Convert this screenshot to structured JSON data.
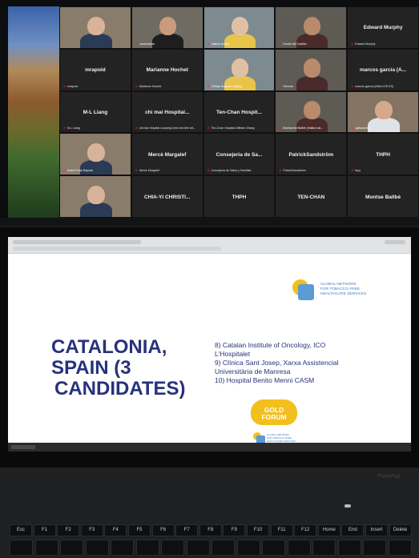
{
  "video_call": {
    "participants": [
      {
        "name": "",
        "tag": "",
        "camera": true
      },
      {
        "name": "",
        "tag": "Laura Antón",
        "camera": true
      },
      {
        "name": "",
        "tag": "Valeria Scalco",
        "camera": true
      },
      {
        "name": "",
        "tag": "Doctor del Castillo",
        "camera": true
      },
      {
        "name": "Edward Murphy",
        "tag": "Edward Murphy",
        "camera": false
      },
      {
        "name": "mrapoid",
        "tag": "mrapoid",
        "camera": false
      },
      {
        "name": "Marianne Hochet",
        "tag": "Marianne Hochet",
        "camera": false
      },
      {
        "name": "",
        "tag": "Chihay Hospital Ltiaying",
        "camera": true
      },
      {
        "name": "",
        "tag": "Veronia",
        "camera": true
      },
      {
        "name": "marcos garcía (A...",
        "tag": "marcos garcía (ANALYZE.ES)",
        "camera": false
      },
      {
        "name": "M-L Liang",
        "tag": "M-L Liang",
        "camera": false
      },
      {
        "name": "chi mai Hospital...",
        "tag": "chi mai Hospital Liouying Chen,kei-tele shi...",
        "camera": false
      },
      {
        "name": "Ten-Chan Hospit...",
        "tag": "Ten-Chan Hospital-William Chang",
        "camera": false
      },
      {
        "name": "",
        "tag": "Montserrat Ballbè (Institut cat...",
        "camera": true
      },
      {
        "name": "",
        "tag": "cgtlsanchez",
        "camera": true
      },
      {
        "name": "",
        "tag": "Isabel Feria Raposo",
        "camera": true
      },
      {
        "name": "Mercè Margalef",
        "tag": "Mercè Margalef",
        "camera": false
      },
      {
        "name": "Consejeria de Sa...",
        "tag": "Consejería de Salud y Familias",
        "camera": false
      },
      {
        "name": "PatrickSandström",
        "tag": "PatrickSandström",
        "camera": false
      },
      {
        "name": "THPH",
        "tag": "thpy",
        "camera": false
      },
      {
        "name": "",
        "tag": "",
        "camera": true
      },
      {
        "name": "CHIA-YI CHRISTI...",
        "tag": "",
        "camera": false
      },
      {
        "name": "THPH",
        "tag": "",
        "camera": false
      },
      {
        "name": "TEN-CHAN",
        "tag": "",
        "camera": false
      },
      {
        "name": "Montse Ballbè",
        "tag": "",
        "camera": false
      }
    ]
  },
  "slide": {
    "title_lines": [
      "CATALONIA,",
      "SPAIN (3",
      "CANDIDATES)"
    ],
    "candidates": [
      "8) Catalan Institute of Oncology, ICO",
      "L'Hospitalet",
      "9) Clínica Sant Josep, Xarxa Assistencial",
      "Universitària de Manresa",
      "10) Hospital Benito Menni CASM"
    ],
    "network_logo_text": [
      "GLOBAL NETWORK",
      "FOR TOBACCO FREE",
      "HEALTHCARE SERVICES"
    ],
    "gold_forum_text": [
      "GOLD",
      "FORUM"
    ],
    "network_logo_small_text": [
      "GLOBAL NETWORK",
      "FOR TOBACCO FREE",
      "HEALTHCARE SERVICES"
    ]
  },
  "laptop": {
    "brand": "ThinkPad"
  },
  "keyboard": {
    "keys": [
      "Esc",
      "F1",
      "F2",
      "F3",
      "F4",
      "F5",
      "F6",
      "F7",
      "F8",
      "F9",
      "F10",
      "F11",
      "F12",
      "Home",
      "End",
      "Insert",
      "Delete"
    ]
  },
  "colors": {
    "slide_title": "#27317c",
    "network_blue": "#3d7fbf",
    "network_yellow": "#f2bf1c",
    "mic_muted": "#e22233"
  }
}
